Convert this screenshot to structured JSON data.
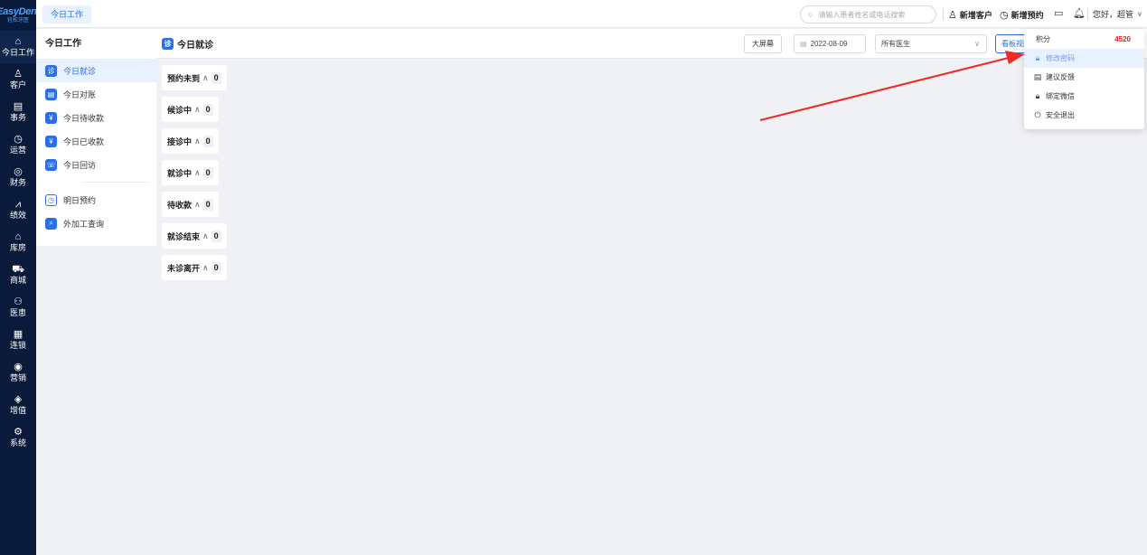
{
  "logo": {
    "brand": "EasyDent",
    "sub": "轻松牙医"
  },
  "rail": [
    {
      "icon": "⌂",
      "label": "今日工作",
      "active": true
    },
    {
      "icon": "♙",
      "label": "客户"
    },
    {
      "icon": "▤",
      "label": "事务"
    },
    {
      "icon": "◷",
      "label": "运营"
    },
    {
      "icon": "◎",
      "label": "财务"
    },
    {
      "icon": "⩘",
      "label": "绩效"
    },
    {
      "icon": "⌂",
      "label": "库房"
    },
    {
      "icon": "⛟",
      "label": "商城"
    },
    {
      "icon": "⚇",
      "label": "医患"
    },
    {
      "icon": "▦",
      "label": "连锁"
    },
    {
      "icon": "◉",
      "label": "营销"
    },
    {
      "icon": "◈",
      "label": "增值"
    },
    {
      "icon": "⚙",
      "label": "系统"
    }
  ],
  "topbar": {
    "tab": "今日工作",
    "search_placeholder": "请输入患者姓名或电话搜索",
    "new_customer": "新增客户",
    "new_appointment": "新增预约",
    "greeting": "您好，超管"
  },
  "subnav": {
    "title": "今日工作",
    "items": [
      {
        "icon": "诊",
        "label": "今日就诊",
        "active": true
      },
      {
        "icon": "▤",
        "label": "今日对账"
      },
      {
        "icon": "¥",
        "label": "今日待收款"
      },
      {
        "icon": "¥",
        "label": "今日已收款"
      },
      {
        "icon": "☏",
        "label": "今日回访"
      }
    ],
    "items2": [
      {
        "icon": "◷",
        "label": "明日预约"
      },
      {
        "icon": "⌕",
        "label": "外加工查询"
      }
    ]
  },
  "main": {
    "title": "今日就诊",
    "big_screen": "大屏幕",
    "date": "2022-08-09",
    "doctor_select": "所有医生",
    "board_btn": "看板视图"
  },
  "status_cards": [
    {
      "label": "预约未到",
      "count": "0"
    },
    {
      "label": "候诊中",
      "count": "0"
    },
    {
      "label": "接诊中",
      "count": "0"
    },
    {
      "label": "就诊中",
      "count": "0"
    },
    {
      "label": "待收款",
      "count": "0"
    },
    {
      "label": "就诊结束",
      "count": "0"
    },
    {
      "label": "未诊离开",
      "count": "0"
    }
  ],
  "dropdown": {
    "points_label": "积分",
    "points_value": "4520",
    "items": [
      {
        "icon": "lock-icon",
        "glyph": "🔒︎",
        "label": "修改密码",
        "active": true
      },
      {
        "icon": "feedback-icon",
        "glyph": "▤",
        "label": "建议反馈"
      },
      {
        "icon": "lock-icon",
        "glyph": "🔒︎",
        "label": "绑定微信"
      },
      {
        "icon": "power-icon",
        "glyph": "⏻",
        "label": "安全退出"
      }
    ]
  },
  "colors": {
    "rail_bg": "#0a1a3a",
    "accent": "#2b6fe6",
    "arrow": "#ee2a24",
    "points": "#e02020"
  }
}
